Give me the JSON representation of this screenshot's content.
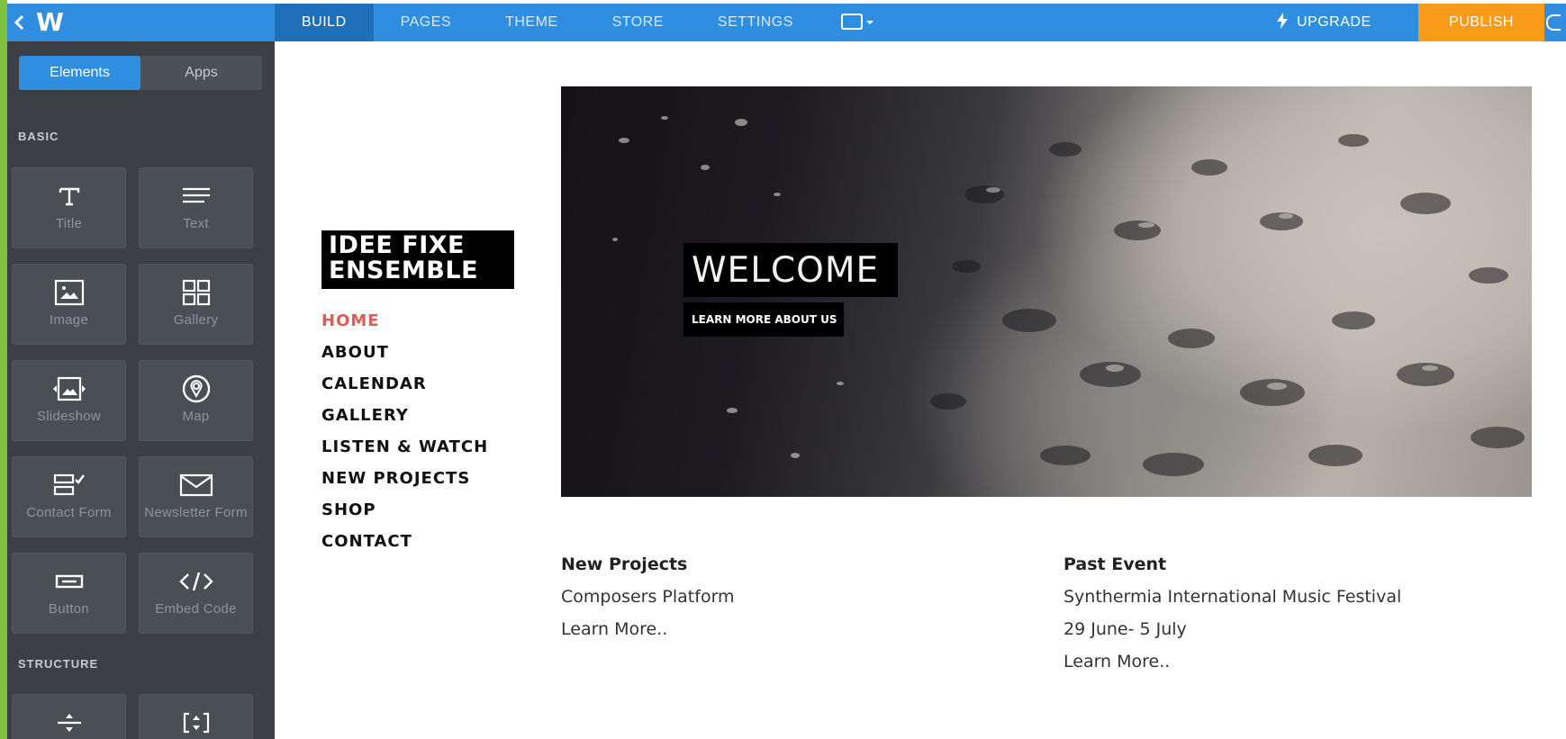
{
  "colors": {
    "topbar": "#2f8ee0",
    "nav_active": "#1f6fb8",
    "publish": "#f99c1a",
    "sidebar": "#3c4045",
    "tile": "#4a4f55",
    "site_accent": "#e05b55",
    "edge_strip": "#7fc241"
  },
  "topbar": {
    "logo": "W",
    "nav": [
      "BUILD",
      "PAGES",
      "THEME",
      "STORE",
      "SETTINGS"
    ],
    "active_nav": "BUILD",
    "upgrade_label": "UPGRADE",
    "publish_label": "PUBLISH"
  },
  "sidebar": {
    "tabs": [
      "Elements",
      "Apps"
    ],
    "active_tab": "Elements",
    "basic_label": "BASIC",
    "structure_label": "STRUCTURE",
    "basic_items": [
      {
        "label": "Title",
        "icon": "title-icon"
      },
      {
        "label": "Text",
        "icon": "text-icon"
      },
      {
        "label": "Image",
        "icon": "image-icon"
      },
      {
        "label": "Gallery",
        "icon": "gallery-icon"
      },
      {
        "label": "Slideshow",
        "icon": "slideshow-icon"
      },
      {
        "label": "Map",
        "icon": "map-icon"
      },
      {
        "label": "Contact Form",
        "icon": "contact-form-icon"
      },
      {
        "label": "Newsletter Form",
        "icon": "newsletter-icon"
      },
      {
        "label": "Button",
        "icon": "button-icon"
      },
      {
        "label": "Embed Code",
        "icon": "embed-code-icon"
      }
    ]
  },
  "site": {
    "logo_line1": "IDEE FIXE",
    "logo_line2": "ENSEMBLE",
    "nav": [
      "HOME",
      "ABOUT",
      "CALENDAR",
      "GALLERY",
      "LISTEN & WATCH",
      "NEW PROJECTS",
      "SHOP",
      "CONTACT"
    ],
    "current_nav": "HOME",
    "hero": {
      "welcome": "WELCOME",
      "cta": "LEARN MORE ABOUT US"
    },
    "columns": {
      "new_projects": {
        "heading": "New Projects",
        "line": "Composers Platform",
        "more": "Learn More.."
      },
      "past_event": {
        "heading": "Past Event",
        "line": "Synthermia International Music Festival",
        "date": "29 June- 5 July",
        "more": "Learn More.."
      }
    }
  }
}
